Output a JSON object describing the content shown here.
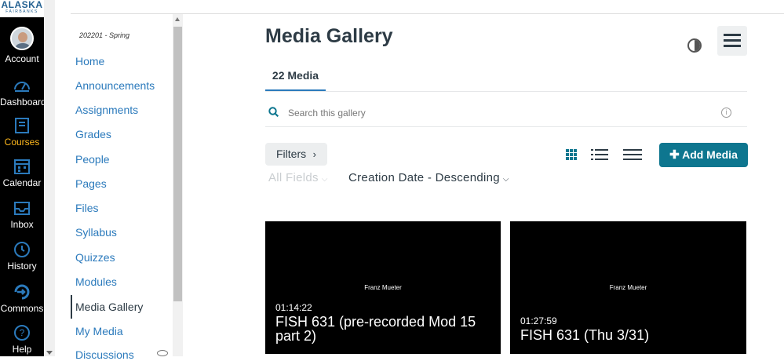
{
  "global_nav": {
    "logo": {
      "line1": "ALASKA",
      "line2": "FAIRBANKS"
    },
    "items": [
      {
        "label": "Account",
        "icon": "avatar"
      },
      {
        "label": "Dashboard",
        "icon": "dashboard-icon"
      },
      {
        "label": "Courses",
        "icon": "courses-icon",
        "active": true
      },
      {
        "label": "Calendar",
        "icon": "calendar-icon"
      },
      {
        "label": "Inbox",
        "icon": "inbox-icon"
      },
      {
        "label": "History",
        "icon": "history-icon"
      },
      {
        "label": "Commons",
        "icon": "commons-icon"
      },
      {
        "label": "Help",
        "icon": "help-icon"
      }
    ],
    "colors": {
      "background": "#000000",
      "icon": "#2b7abc",
      "active": "#FFB81C"
    }
  },
  "course_nav": {
    "term": "202201 - Spring",
    "links": [
      "Home",
      "Announcements",
      "Assignments",
      "Grades",
      "People",
      "Pages",
      "Files",
      "Syllabus",
      "Quizzes",
      "Modules",
      "Media Gallery",
      "My Media",
      "Discussions"
    ],
    "active": "Media Gallery"
  },
  "main": {
    "title": "Media Gallery",
    "tab_label": "22 Media",
    "search_placeholder": "Search this gallery",
    "filters_label": "Filters",
    "add_media_label": "Add Media",
    "sort_fields": "All Fields",
    "sort_order": "Creation Date - Descending",
    "accent": "#0e768f",
    "media": [
      {
        "author": "Franz Mueter",
        "duration": "01:14:22",
        "title": "FISH 631 (pre-recorded Mod 15 part 2)"
      },
      {
        "author": "Franz Mueter",
        "duration": "01:27:59",
        "title": "FISH 631 (Thu 3/31)"
      }
    ]
  }
}
